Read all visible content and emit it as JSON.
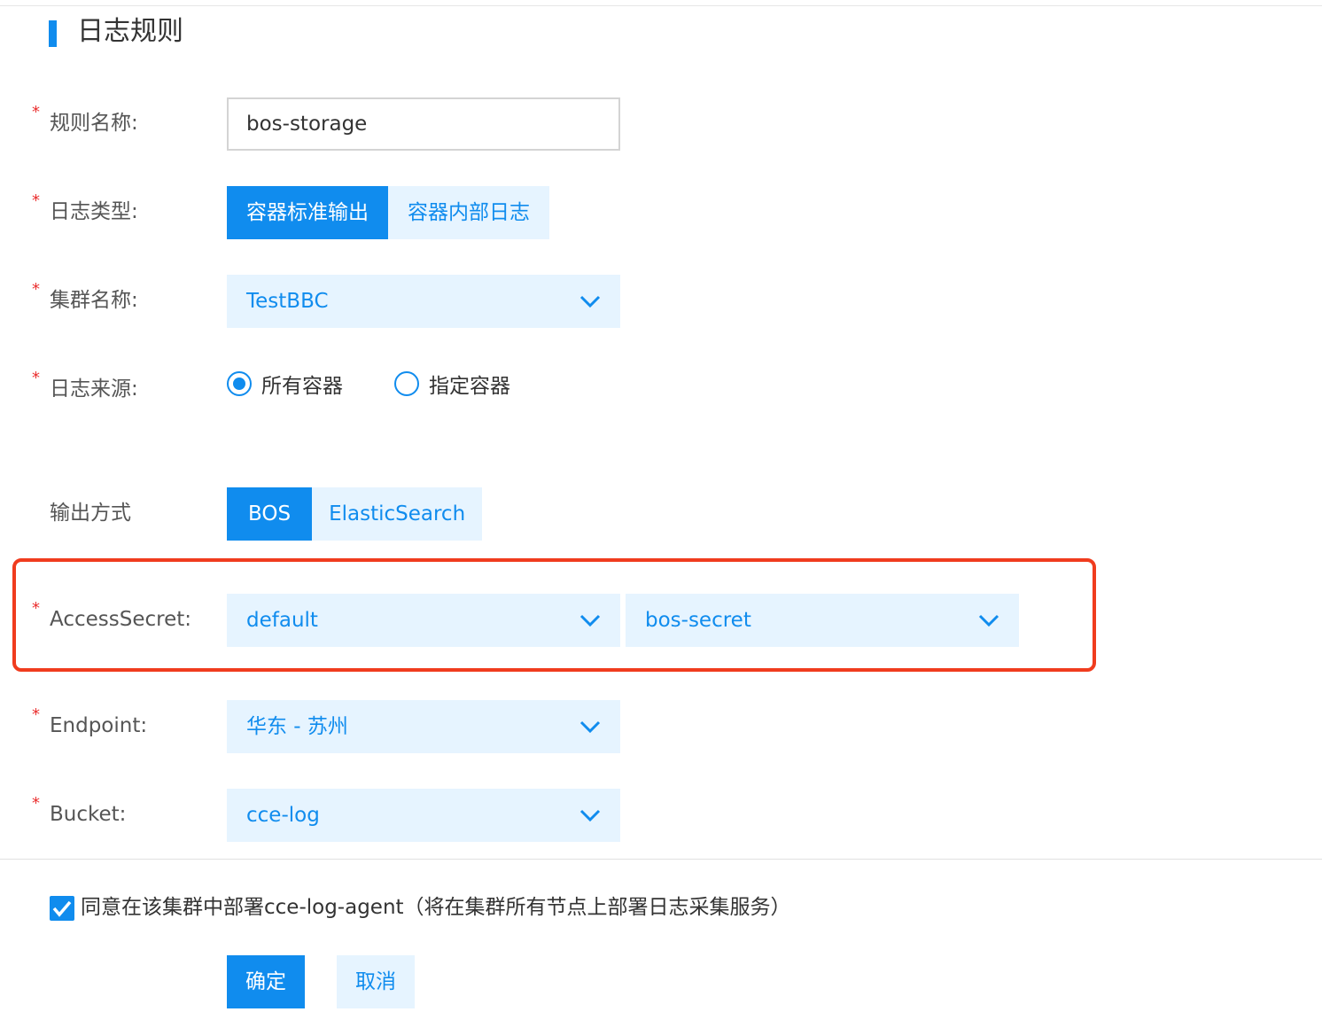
{
  "section": {
    "title": "日志规则"
  },
  "form": {
    "rule_name": {
      "label": "规则名称:",
      "value": "bos-storage"
    },
    "log_type": {
      "label": "日志类型:",
      "options": [
        "容器标准输出",
        "容器内部日志"
      ],
      "selected": "容器标准输出"
    },
    "cluster": {
      "label": "集群名称:",
      "value": "TestBBC"
    },
    "log_source": {
      "label": "日志来源:",
      "options": [
        "所有容器",
        "指定容器"
      ],
      "selected": "所有容器"
    },
    "output": {
      "label": "输出方式",
      "options": [
        "BOS",
        "ElasticSearch"
      ],
      "selected": "BOS"
    },
    "access_secret": {
      "label": "AccessSecret:",
      "namespace": "default",
      "secret": "bos-secret"
    },
    "endpoint": {
      "label": "Endpoint:",
      "value": "华东 - 苏州"
    },
    "bucket": {
      "label": "Bucket:",
      "value": "cce-log"
    },
    "required_mark": "*"
  },
  "agreement": {
    "checked": true,
    "text": "同意在该集群中部署cce-log-agent（将在集群所有节点上部署日志采集服务）"
  },
  "actions": {
    "confirm": "确定",
    "cancel": "取消"
  },
  "colors": {
    "primary": "#108cee",
    "light": "#e6f4ff",
    "highlight": "#f03c1e",
    "required": "#ea2e2e"
  },
  "icons": {
    "chevron": "chevron-down-icon",
    "check": "checkmark-icon"
  }
}
